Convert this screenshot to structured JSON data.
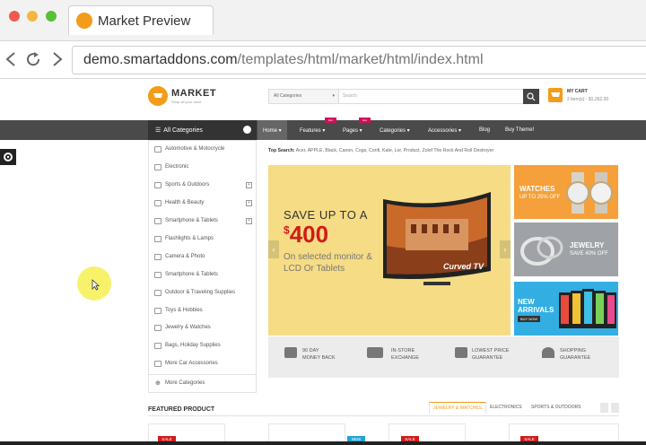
{
  "browser": {
    "tab_title": "Market Preview",
    "url_host": "demo.smartaddons.com",
    "url_path": "/templates/html/market/html/index.html"
  },
  "header": {
    "logo_title": "MARKET",
    "logo_sub": "Shop all your want",
    "search_category": "All Categories",
    "search_placeholder": "Search",
    "cart_title": "MY CART",
    "cart_info": "2 item(s) - $1,262.00"
  },
  "nav": {
    "all_categories": "All Categories",
    "items": [
      {
        "label": "Home ▾"
      },
      {
        "label": "Features ▾",
        "badge": "Hot"
      },
      {
        "label": "Pages ▾",
        "badge": "Hot"
      },
      {
        "label": "Categories ▾"
      },
      {
        "label": "Accessories ▾"
      },
      {
        "label": "Blog"
      },
      {
        "label": "Buy Theme!"
      }
    ]
  },
  "sidebar": {
    "items": [
      {
        "label": "Automotive & Motocrycle",
        "expand": false
      },
      {
        "label": "Electronic",
        "expand": false
      },
      {
        "label": "Sports & Outdoors",
        "expand": true
      },
      {
        "label": "Health & Beauty",
        "expand": true
      },
      {
        "label": "Smartphone & Tablets",
        "expand": true
      },
      {
        "label": "Flashlights & Lamps",
        "expand": false
      },
      {
        "label": "Camera & Photo",
        "expand": false
      },
      {
        "label": "Smartphone & Tablets",
        "expand": false
      },
      {
        "label": "Outdoor & Traveling Supplies",
        "expand": false
      },
      {
        "label": "Toys & Hobbies",
        "expand": false
      },
      {
        "label": "Jewelry & Watches",
        "expand": false
      },
      {
        "label": "Bags, Holiday Supplies",
        "expand": false
      },
      {
        "label": "More Car Accessories",
        "expand": false
      }
    ],
    "more": "More Categories"
  },
  "top_search": {
    "label": "Top Search:",
    "terms": "Acer,  APPLE,  Black,  Canon,  Cogs,  Confi,  Kate,  Lor,  Product,  Zolof The Rock And Roll Destroyer"
  },
  "slider": {
    "save": "SAVE UP TO A",
    "price_symbol": "$",
    "price": "400",
    "desc": "On selected monitor & LCD Or Tablets",
    "tv_text": "Curved TV"
  },
  "banners": [
    {
      "title": "WATCHES",
      "sub": "UP TO 25% OFF"
    },
    {
      "title": "JEWELRY",
      "sub": "SAVE 40% OFF"
    },
    {
      "title": "NEW ARRIVALS",
      "sub": "BUY NOW"
    }
  ],
  "services": [
    {
      "line1": "90 DAY",
      "line2": "MONEY BACK"
    },
    {
      "line1": "IN-STORE",
      "line2": "EXCHANGE"
    },
    {
      "line1": "LOWEST PRICE",
      "line2": "GUARANTEE"
    },
    {
      "line1": "SHOPPING",
      "line2": "GUARANTEE"
    }
  ],
  "featured": {
    "title": "FEATURED PRODUCT",
    "tabs": [
      "JEWELRY & WATCHES",
      "ELECTRONICS",
      "SPORTS & OUTDOORS"
    ],
    "badges": [
      "SALE",
      "NEW",
      "SALE",
      "SALE"
    ]
  },
  "colors": {
    "accent": "#f39c1a",
    "nav_bg": "#4a4a4a",
    "slider_bg": "#f6dc85",
    "sale": "#d21a1a"
  }
}
